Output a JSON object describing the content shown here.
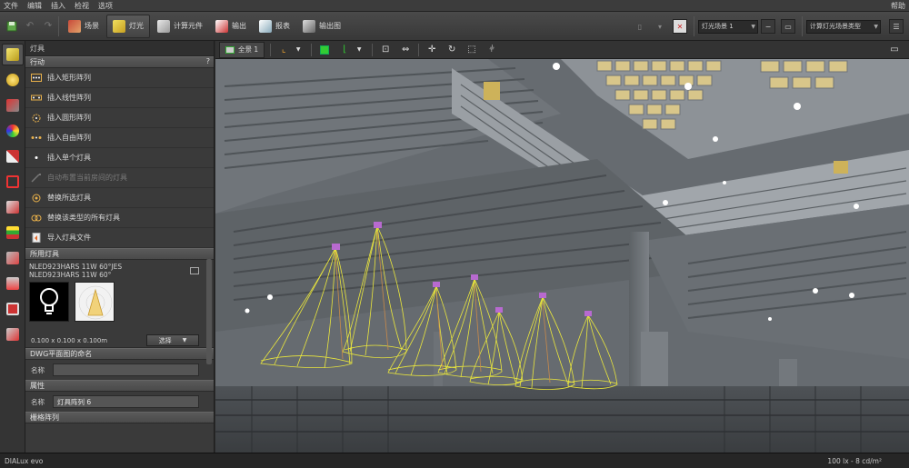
{
  "menu": {
    "items": [
      "文件",
      "编辑",
      "插入",
      "检视",
      "选项"
    ],
    "user": "帮助"
  },
  "toolbar": {
    "buttons": [
      {
        "label": "场景"
      },
      {
        "label": "灯光"
      },
      {
        "label": "计算元件"
      },
      {
        "label": "输出"
      },
      {
        "label": "报表"
      },
      {
        "label": "输出图"
      }
    ],
    "light_scene": "灯光场景 1",
    "calc_scene": "计算灯光场景类型"
  },
  "panel": {
    "title": "灯具",
    "actions_header": "行动",
    "help": "?",
    "actions": [
      {
        "label": "插入矩形阵列",
        "enabled": true
      },
      {
        "label": "插入线性阵列",
        "enabled": true
      },
      {
        "label": "插入圆形阵列",
        "enabled": true
      },
      {
        "label": "插入自由阵列",
        "enabled": true
      },
      {
        "label": "插入单个灯具",
        "enabled": true
      },
      {
        "label": "自动布置当前房间的灯具",
        "enabled": false
      },
      {
        "label": "替换所选灯具",
        "enabled": true
      },
      {
        "label": "替换该类型的所有灯具",
        "enabled": true
      },
      {
        "label": "导入灯具文件",
        "enabled": true
      }
    ],
    "luminaire_header": "所用灯具",
    "luminaire_name_1": "NLED923HARS 11W 60°JES",
    "luminaire_name_2": "NLED923HARS 11W 60°",
    "luminaire_dims": "0.100 x 0.100 x 0.100m",
    "select_label": "选择",
    "dwg_header": "DWG平面图的命名",
    "dwg_name_label": "名称",
    "dwg_name_value": "",
    "props_header": "属性",
    "props_name_label": "名称",
    "props_name_value": "灯具阵列 6",
    "grid_header": "栅格阵列"
  },
  "viewport": {
    "tab_label": "全景 1"
  },
  "status": {
    "app": "DIALux evo",
    "units": "100 lx - 8 cd/m²"
  }
}
